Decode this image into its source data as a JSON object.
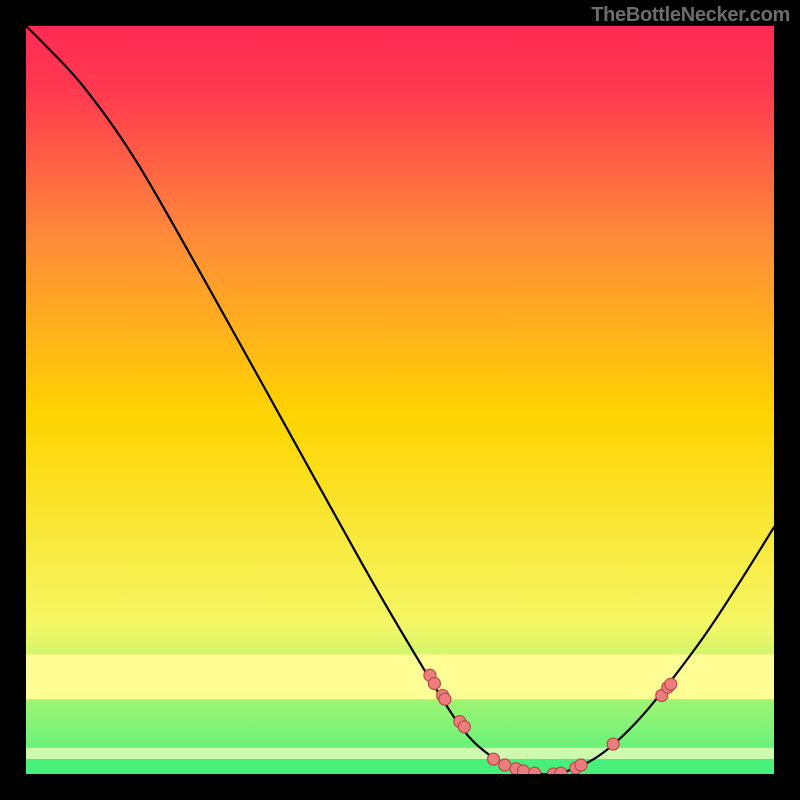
{
  "watermark": "TheBottleNecker.com",
  "chart_data": {
    "type": "line",
    "title": "",
    "xlabel": "",
    "ylabel": "",
    "xlim": [
      0,
      100
    ],
    "ylim": [
      0,
      100
    ],
    "curve": [
      {
        "x": 0.0,
        "y": 100.0
      },
      {
        "x": 3.0,
        "y": 97.0
      },
      {
        "x": 8.0,
        "y": 91.5
      },
      {
        "x": 15.0,
        "y": 81.5
      },
      {
        "x": 25.0,
        "y": 64.0
      },
      {
        "x": 35.0,
        "y": 46.0
      },
      {
        "x": 45.0,
        "y": 28.0
      },
      {
        "x": 52.0,
        "y": 16.0
      },
      {
        "x": 58.0,
        "y": 6.5
      },
      {
        "x": 62.0,
        "y": 2.5
      },
      {
        "x": 66.0,
        "y": 0.5
      },
      {
        "x": 70.0,
        "y": 0.0
      },
      {
        "x": 74.0,
        "y": 1.0
      },
      {
        "x": 78.0,
        "y": 3.5
      },
      {
        "x": 83.0,
        "y": 8.5
      },
      {
        "x": 90.0,
        "y": 17.5
      },
      {
        "x": 95.0,
        "y": 25.0
      },
      {
        "x": 100.0,
        "y": 33.0
      }
    ],
    "markers": [
      {
        "x": 54.0,
        "y": 13.2
      },
      {
        "x": 54.6,
        "y": 12.1
      },
      {
        "x": 55.7,
        "y": 10.5
      },
      {
        "x": 56.0,
        "y": 10.0
      },
      {
        "x": 58.0,
        "y": 7.0
      },
      {
        "x": 58.6,
        "y": 6.3
      },
      {
        "x": 62.5,
        "y": 2.0
      },
      {
        "x": 64.0,
        "y": 1.2
      },
      {
        "x": 65.5,
        "y": 0.7
      },
      {
        "x": 66.5,
        "y": 0.4
      },
      {
        "x": 68.0,
        "y": 0.1
      },
      {
        "x": 70.5,
        "y": 0.0
      },
      {
        "x": 71.5,
        "y": 0.1
      },
      {
        "x": 73.5,
        "y": 0.8
      },
      {
        "x": 74.2,
        "y": 1.2
      },
      {
        "x": 78.5,
        "y": 4.0
      },
      {
        "x": 85.0,
        "y": 10.5
      },
      {
        "x": 85.8,
        "y": 11.6
      },
      {
        "x": 86.2,
        "y": 12.0
      }
    ],
    "highlight_band": {
      "y_from": 10.0,
      "y_to": 16.0,
      "color": "#fffe94",
      "alpha": 1.0
    },
    "good_band": {
      "y_from": 0.0,
      "y_to": 2.0,
      "color": "#46f07a",
      "alpha": 1.0
    },
    "bg_gradient": {
      "top": "#ff2a55",
      "mid": "#ffd400",
      "bot": "#4df17f"
    },
    "marker_style": {
      "fill": "#ed7d7d",
      "stroke": "#b74a4a",
      "r": 6
    },
    "line_style": {
      "stroke": "#000000",
      "width": 2.2
    }
  }
}
